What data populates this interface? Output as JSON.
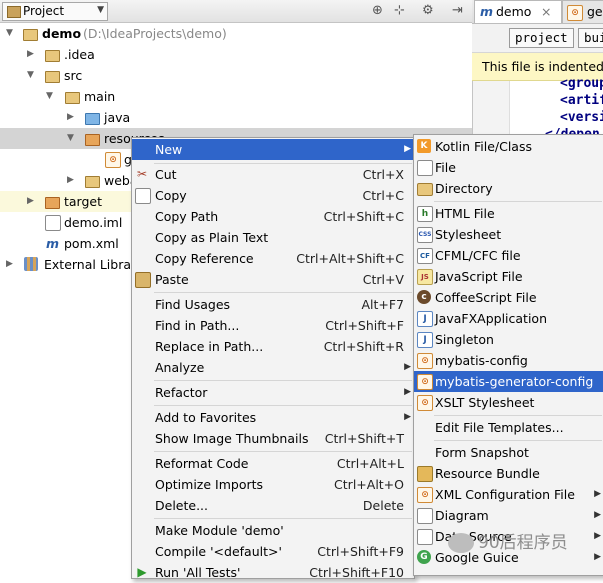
{
  "project_panel": {
    "title": "Project",
    "header_icons": [
      "target-icon",
      "split-icon",
      "gear-icon",
      "hide-icon"
    ],
    "tree": [
      {
        "label": "demo",
        "path": "(D:\\IdeaProjects\\demo)"
      },
      {
        "label": ".idea"
      },
      {
        "label": "src"
      },
      {
        "label": "main"
      },
      {
        "label": "java"
      },
      {
        "label": "resources"
      },
      {
        "label": "g"
      },
      {
        "label": "weba"
      },
      {
        "label": "target"
      },
      {
        "label": "demo.iml"
      },
      {
        "label": "pom.xml"
      },
      {
        "label": "External Librari"
      }
    ]
  },
  "editor": {
    "tabs": [
      {
        "label": "demo"
      },
      {
        "label": "ger"
      }
    ],
    "breadcrumbs": [
      "project",
      "bui"
    ],
    "notice": "This file is indented w",
    "code_lines": [
      "<group",
      "<artif",
      "<versi",
      "</depen"
    ]
  },
  "context_menu": {
    "items": [
      {
        "label": "New",
        "shortcut": "",
        "submenu": true,
        "selected": true,
        "icon": "new-icon"
      },
      {
        "label": "Cut",
        "shortcut": "Ctrl+X",
        "icon": "scissors-icon"
      },
      {
        "label": "Copy",
        "shortcut": "Ctrl+C",
        "icon": "copy-icon"
      },
      {
        "label": "Copy Path",
        "shortcut": "Ctrl+Shift+C"
      },
      {
        "label": "Copy as Plain Text",
        "shortcut": ""
      },
      {
        "label": "Copy Reference",
        "shortcut": "Ctrl+Alt+Shift+C"
      },
      {
        "label": "Paste",
        "shortcut": "Ctrl+V",
        "icon": "paste-icon"
      },
      {
        "label": "Find Usages",
        "shortcut": "Alt+F7"
      },
      {
        "label": "Find in Path...",
        "shortcut": "Ctrl+Shift+F"
      },
      {
        "label": "Replace in Path...",
        "shortcut": "Ctrl+Shift+R"
      },
      {
        "label": "Analyze",
        "shortcut": "",
        "submenu": true
      },
      {
        "label": "Refactor",
        "shortcut": "",
        "submenu": true
      },
      {
        "label": "Add to Favorites",
        "shortcut": "",
        "submenu": true
      },
      {
        "label": "Show Image Thumbnails",
        "shortcut": "Ctrl+Shift+T"
      },
      {
        "label": "Reformat Code",
        "shortcut": "Ctrl+Alt+L"
      },
      {
        "label": "Optimize Imports",
        "shortcut": "Ctrl+Alt+O"
      },
      {
        "label": "Delete...",
        "shortcut": "Delete"
      },
      {
        "label": "Make Module 'demo'",
        "shortcut": ""
      },
      {
        "label": "Compile '<default>'",
        "shortcut": "Ctrl+Shift+F9"
      },
      {
        "label": "Run 'All Tests'",
        "shortcut": "Ctrl+Shift+F10",
        "icon": "run-icon"
      }
    ]
  },
  "new_submenu": {
    "items": [
      {
        "label": "Kotlin File/Class",
        "icon": "kotlin-icon"
      },
      {
        "label": "File",
        "icon": "file-icon"
      },
      {
        "label": "Directory",
        "icon": "folder-icon"
      },
      {
        "label": "HTML File",
        "icon": "html-icon"
      },
      {
        "label": "Stylesheet",
        "icon": "css-icon"
      },
      {
        "label": "CFML/CFC file",
        "icon": "cfml-icon"
      },
      {
        "label": "JavaScript File",
        "icon": "javascript-icon"
      },
      {
        "label": "CoffeeScript File",
        "icon": "coffeescript-icon"
      },
      {
        "label": "JavaFXApplication",
        "icon": "javafx-icon"
      },
      {
        "label": "Singleton",
        "icon": "java-class-icon"
      },
      {
        "label": "mybatis-config",
        "icon": "xml-icon"
      },
      {
        "label": "mybatis-generator-config",
        "icon": "xml-icon",
        "selected": true
      },
      {
        "label": "XSLT Stylesheet",
        "icon": "xslt-icon"
      },
      {
        "label": "Edit File Templates...",
        "icon": ""
      },
      {
        "label": "Form Snapshot",
        "icon": ""
      },
      {
        "label": "Resource Bundle",
        "icon": "bundle-icon"
      },
      {
        "label": "XML Configuration File",
        "icon": "xml-icon",
        "submenu": true
      },
      {
        "label": "Diagram",
        "icon": "diagram-icon",
        "submenu": true
      },
      {
        "label": "Data Source",
        "icon": "datasource-icon",
        "submenu": true
      },
      {
        "label": "Google Guice",
        "icon": "guice-icon",
        "submenu": true
      }
    ]
  },
  "watermark": "90后程序员"
}
